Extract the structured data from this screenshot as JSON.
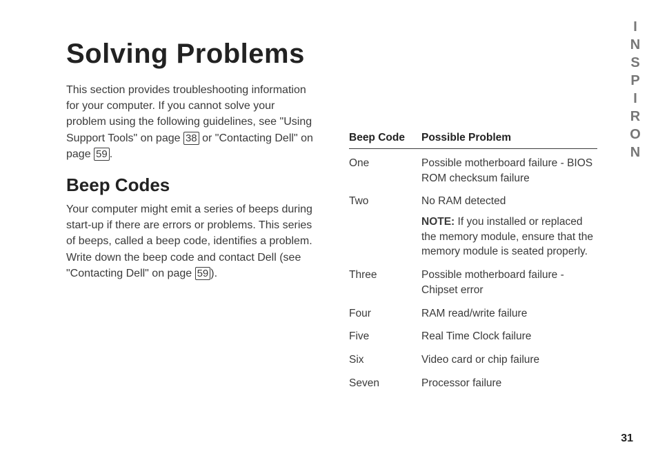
{
  "brand": "INSPIRON",
  "title": "Solving Problems",
  "intro_parts": {
    "p1": "This section provides troubleshooting information for your computer. If you cannot solve your problem using the following guidelines, see \"Using Support Tools\" on page ",
    "ref1": "38",
    "p2": " or \"Contacting Dell\" on page ",
    "ref2": "59",
    "p3": "."
  },
  "section2_title": "Beep Codes",
  "section2_body_parts": {
    "p1": "Your computer might emit a series of beeps during start-up if there are errors or problems. This series of beeps, called a beep code, identifies a problem. Write down the beep code and contact Dell (see \"Contacting Dell\" on page ",
    "ref1": "59",
    "p2": ")."
  },
  "table": {
    "head_code": "Beep Code",
    "head_problem": "Possible Problem",
    "rows": [
      {
        "code": "One",
        "problem": "Possible motherboard failure - BIOS ROM checksum failure"
      },
      {
        "code": "Two",
        "problem": "No RAM detected",
        "note_label": "NOTE:",
        "note_text": " If you installed or replaced the memory module, ensure that the memory module is seated properly."
      },
      {
        "code": "Three",
        "problem": "Possible motherboard failure - Chipset error"
      },
      {
        "code": "Four",
        "problem": "RAM read/write failure"
      },
      {
        "code": "Five",
        "problem": "Real Time Clock failure"
      },
      {
        "code": "Six",
        "problem": "Video card or chip failure"
      },
      {
        "code": "Seven",
        "problem": "Processor failure"
      }
    ]
  },
  "page_number": "31"
}
